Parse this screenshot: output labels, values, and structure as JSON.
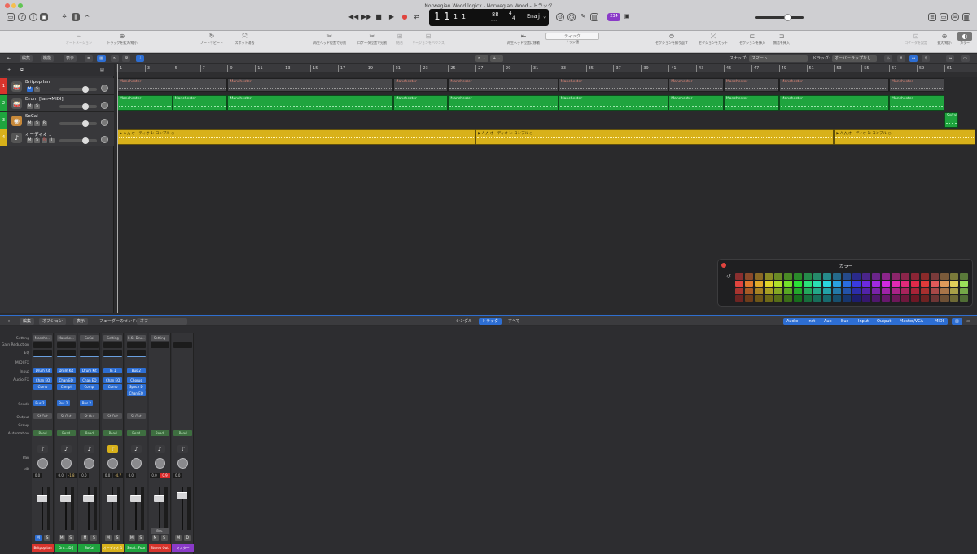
{
  "window": {
    "title": "Norwegian Wood.logicx - Norwegian Wood - トラック"
  },
  "titlebar": {
    "left_icons": [
      "inbox-icon",
      "help-icon",
      "info-icon",
      "library-icon",
      "brightness-icon",
      "mixer-icon",
      "scissors-icon"
    ],
    "right_icons": [
      "list-icon",
      "note-icon",
      "loops-icon",
      "browser-icon",
      "media-icon"
    ]
  },
  "transport": {
    "bar": "1",
    "beat": "1",
    "div": "1",
    "tick": "1",
    "tempo": "88",
    "tempo_label": "KEEP",
    "sig_top": "4",
    "sig_bottom": "4",
    "key": "Emaj",
    "lcd_sub": [
      "BAR",
      "BEAT",
      "DIV",
      "TICK",
      "TEMPO",
      "",
      "",
      "KEY"
    ],
    "count": "234"
  },
  "toolbar": {
    "items": [
      {
        "icon": "automation-icon",
        "label": "オートメーション"
      },
      {
        "icon": "expand-icon",
        "label": "トラックを拡大/縮小"
      },
      {
        "icon": "repeat-icon",
        "label": "ノートリピート"
      },
      {
        "icon": "spot-icon",
        "label": "スポット消去"
      },
      {
        "icon": "split-icon",
        "label": "再生ヘッド位置で分割"
      },
      {
        "icon": "split-loc-icon",
        "label": "ロケータ位置で分割"
      },
      {
        "icon": "join-icon",
        "label": "結合"
      },
      {
        "icon": "bounce-icon",
        "label": "リージョンをバウンス"
      },
      {
        "icon": "playhead-icon",
        "label": "再生ヘッド位置に移動"
      },
      {
        "icon": "snap-icon",
        "label": "ナッジ値"
      },
      {
        "icon": "repeat-section-icon",
        "label": "セクションを繰り返す"
      },
      {
        "icon": "cut-section-icon",
        "label": "セクションをカット"
      },
      {
        "icon": "insert-section-icon",
        "label": "セクションを挿入"
      },
      {
        "icon": "insert-silence-icon",
        "label": "無音を挿入"
      },
      {
        "icon": "locator-icon",
        "label": "ロケータを設定"
      },
      {
        "icon": "zoom-icon",
        "label": "拡大/縮小"
      },
      {
        "icon": "color-icon",
        "label": "カラー"
      }
    ],
    "nudge": "ティック"
  },
  "arrange": {
    "menus": [
      "編集",
      "機能",
      "表示"
    ],
    "snap_label": "スナップ:",
    "snap_value": "スマート",
    "drag_label": "ドラッグ:",
    "drag_value": "オーバーラップなし"
  },
  "ruler": {
    "marks": [
      "1",
      "3",
      "5",
      "7",
      "9",
      "11",
      "13",
      "15",
      "17",
      "19",
      "21",
      "23",
      "25",
      "27",
      "29",
      "31",
      "33",
      "35",
      "37",
      "39",
      "41",
      "43",
      "45",
      "47",
      "49",
      "51",
      "53",
      "55",
      "57",
      "59",
      "61"
    ]
  },
  "tracks": [
    {
      "num": "1",
      "name": "Britpop Ian",
      "buttons": [
        "M",
        "S"
      ],
      "color": "#d8342c",
      "icon": "drum-icon"
    },
    {
      "num": "2",
      "name": "Drum [Ian→MIDI]",
      "buttons": [
        "M",
        "S"
      ],
      "color": "#1fa43e",
      "icon": "drum-icon"
    },
    {
      "num": "3",
      "name": "SoCal",
      "buttons": [
        "M",
        "S",
        "R"
      ],
      "color": "#1fa43e",
      "icon": "drum-kit-icon"
    },
    {
      "num": "4",
      "name": "オーディオ 1",
      "buttons": [
        "M",
        "S",
        "R",
        "I"
      ],
      "color": "#d8b11a",
      "icon": "guitar-icon"
    }
  ],
  "regions": {
    "track1": [
      {
        "label": "Manchester",
        "start": 1,
        "end": 9
      },
      {
        "label": "Manchester",
        "start": 9,
        "end": 21
      },
      {
        "label": "Manchester",
        "start": 21,
        "end": 25
      },
      {
        "label": "Manchester",
        "start": 25,
        "end": 33
      },
      {
        "label": "Manchester",
        "start": 33,
        "end": 41
      },
      {
        "label": "Manchester",
        "start": 41,
        "end": 45
      },
      {
        "label": "Manchester",
        "start": 45,
        "end": 49
      },
      {
        "label": "Manchester",
        "start": 49,
        "end": 57
      },
      {
        "label": "Manchester",
        "start": 57,
        "end": 61
      }
    ],
    "track2": [
      {
        "label": "Manchester",
        "start": 1,
        "end": 5
      },
      {
        "label": "Manchester",
        "start": 5,
        "end": 9
      },
      {
        "label": "Manchester",
        "start": 9,
        "end": 21
      },
      {
        "label": "Manchester",
        "start": 21,
        "end": 25
      },
      {
        "label": "Manchester",
        "start": 25,
        "end": 33
      },
      {
        "label": "Manchester",
        "start": 33,
        "end": 41
      },
      {
        "label": "Manchester",
        "start": 41,
        "end": 45
      },
      {
        "label": "Manchester",
        "start": 45,
        "end": 49
      },
      {
        "label": "Manchester",
        "start": 49,
        "end": 57
      },
      {
        "label": "Manchester",
        "start": 57,
        "end": 61
      }
    ],
    "track3": [
      {
        "label": "SoCal",
        "start": 61,
        "end": 62
      }
    ],
    "track4": [
      {
        "label": "オーディオ 1: コンプル",
        "start": 1,
        "end": 27
      },
      {
        "label": "オーディオ 1: コンプル",
        "start": 27,
        "end": 53
      },
      {
        "label": "オーディオ 1: コンプル",
        "start": 53,
        "end": 64
      }
    ]
  },
  "color_panel": {
    "title": "カラー",
    "colors": [
      "#8a2f2f",
      "#8a4a2a",
      "#8a6a25",
      "#8a8a25",
      "#6a8a25",
      "#4a8a25",
      "#2a8a2a",
      "#258a4a",
      "#258a6a",
      "#258a8a",
      "#256a8a",
      "#254a8a",
      "#2a2a8a",
      "#4a258a",
      "#6a258a",
      "#8a258a",
      "#8a256a",
      "#8a254a",
      "#8a2535",
      "#8a2a2a",
      "#7a3a3a",
      "#7a5a3a",
      "#7a7a3a",
      "#5a7a3a",
      "#e0443e",
      "#e0782d",
      "#e0a92a",
      "#e0d52a",
      "#b0e02a",
      "#74e02a",
      "#2ae036",
      "#2ae07a",
      "#2ae0b4",
      "#2ad6e0",
      "#2aa0e0",
      "#2a6ce0",
      "#3a3ae0",
      "#6c2ae0",
      "#a02ae0",
      "#d02ae0",
      "#e02ab4",
      "#e02a7a",
      "#e02a4a",
      "#e03a3a",
      "#e05a5a",
      "#e09a5a",
      "#e0d05a",
      "#9ae05a",
      "#a8342f",
      "#a85a25",
      "#a88323",
      "#a8a023",
      "#84a823",
      "#58a823",
      "#23a82b",
      "#23a85c",
      "#23a888",
      "#23a2a8",
      "#2379a8",
      "#2352a8",
      "#2c2ca8",
      "#5223a8",
      "#7923a8",
      "#9e23a8",
      "#a82388",
      "#a8235c",
      "#a82338",
      "#a82f2f",
      "#a84848",
      "#a87448",
      "#a8a048",
      "#74a848",
      "#6e2422",
      "#6e3c1a",
      "#6e5617",
      "#6e6917",
      "#576e17",
      "#3a6e17",
      "#176e1c",
      "#176e3c",
      "#176e5a",
      "#176a6e",
      "#17506e",
      "#17366e",
      "#1d1d6e",
      "#36176e",
      "#50176e",
      "#68176e",
      "#6e175a",
      "#6e173c",
      "#6e1725",
      "#6e2222",
      "#6e3535",
      "#6e5035",
      "#6e6a35",
      "#506e35"
    ]
  },
  "mixer": {
    "menus": [
      "編集",
      "オプション",
      "表示"
    ],
    "sends_label": "フェーダーのセンド:",
    "sends_value": "オフ",
    "view_tabs": [
      "シングル",
      "トラック",
      "すべて"
    ],
    "view_active": "トラック",
    "filters": [
      "Audio",
      "Inst",
      "Aux",
      "Bus",
      "Input",
      "Output",
      "Master/VCA",
      "MIDI"
    ],
    "row_labels": [
      "Setting",
      "Gain Reduction",
      "EQ",
      "MIDI FX",
      "Input",
      "Audio FX",
      "Sends",
      "Output",
      "Group",
      "Automation",
      "Pan",
      "dB"
    ],
    "strips": [
      {
        "setting": "Manche...",
        "input": "Drum Kit",
        "fx": [
          "Chan EQ",
          "Comp"
        ],
        "send": "Bus 2",
        "output": "St Out",
        "auto": "Read",
        "db": "0.0",
        "db2": "",
        "name": "Britpop Ian",
        "color": "#d8342c",
        "icon": "drum-icon",
        "buttons": [
          "M",
          "S"
        ]
      },
      {
        "setting": "Manche...",
        "input": "Drum Kit",
        "fx": [
          "Chan EQ",
          "Compl"
        ],
        "send": "Bus 2",
        "output": "St Out",
        "auto": "Read",
        "db": "0.0",
        "db2": "-1.8",
        "name": "Dru...IDI]",
        "color": "#1fa43e",
        "icon": "drum-icon",
        "buttons": [
          "M",
          "S"
        ]
      },
      {
        "setting": "SoCal",
        "input": "Drum Kit",
        "fx": [
          "Chan EQ",
          "Compl"
        ],
        "send": "Bus 2",
        "output": "St Out",
        "auto": "Read",
        "db": "0.0",
        "db2": "",
        "name": "SoCal",
        "color": "#1fa43e",
        "icon": "drum-kit-icon",
        "buttons": [
          "M",
          "S"
        ]
      },
      {
        "setting": "Setting",
        "input": "In 1",
        "fx": [
          "Chan EQ",
          "Comp"
        ],
        "send": "",
        "output": "St Out",
        "auto": "Read",
        "db": "0.0",
        "db2": "-4.7",
        "name": "オーディオ 1",
        "color": "#d8b11a",
        "icon": "guitar-icon",
        "buttons": [
          "M",
          "S"
        ]
      },
      {
        "setting": "0.6s Dru...",
        "input": "Bus 2",
        "fx": [
          "Chorus",
          "Space D",
          "Chan EQ"
        ],
        "send": "",
        "output": "St Out",
        "auto": "Read",
        "db": "0.0",
        "db2": "",
        "name": "Smal...Four",
        "color": "#1fa43e",
        "icon": "aux-icon",
        "buttons": [
          "M",
          "S"
        ]
      },
      {
        "setting": "Setting",
        "input": "",
        "fx": [],
        "send": "",
        "output": "",
        "auto": "Read",
        "db": "0.0",
        "db2": "0.9",
        "name": "Stereo Out",
        "color": "#d8342c",
        "icon": "wave-icon",
        "buttons": [
          "M",
          "S"
        ],
        "extra": "Bnc"
      },
      {
        "setting": "",
        "input": "",
        "fx": [],
        "send": "",
        "output": "",
        "auto": "Read",
        "db": "0.0",
        "db2": "",
        "name": "マスター",
        "color": "#8a3ac8",
        "icon": "wave-icon",
        "buttons": [
          "M",
          "D"
        ]
      }
    ]
  }
}
